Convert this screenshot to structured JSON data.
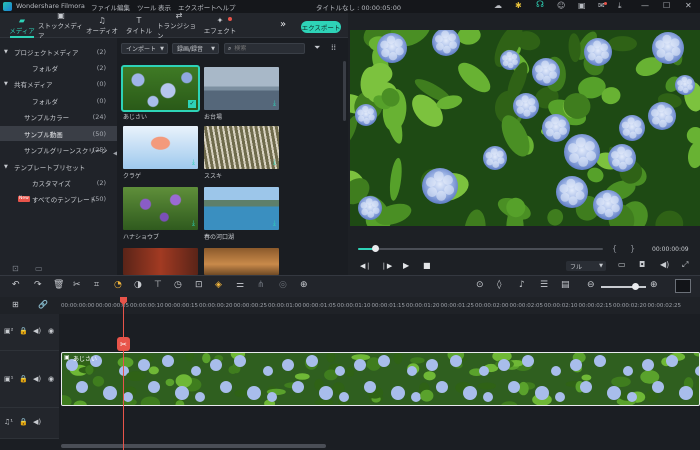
{
  "app": {
    "title": "Wondershare Filmora",
    "menu": [
      "ファイル",
      "編集",
      "ツール",
      "表示",
      "エクスポート",
      "ヘルプ"
    ],
    "project_title": "タイトルなし : 00:00:05:00"
  },
  "tabs": [
    {
      "label": "メディア",
      "icon": "folder-icon"
    },
    {
      "label": "ストックメディア",
      "icon": "image-icon"
    },
    {
      "label": "オーディオ",
      "icon": "music-note-icon"
    },
    {
      "label": "タイトル",
      "icon": "text-icon"
    },
    {
      "label": "トランジション",
      "icon": "transition-icon"
    },
    {
      "label": "エフェクト",
      "icon": "effect-icon"
    }
  ],
  "export_label": "エクスポート",
  "sidebar": [
    {
      "label": "プロジェクトメディア",
      "count": "(2)",
      "indent": 0,
      "arrow": "▼"
    },
    {
      "label": "フォルダ",
      "count": "(2)",
      "indent": 1,
      "arrow": ""
    },
    {
      "label": "共有メディア",
      "count": "(0)",
      "indent": 0,
      "arrow": "▼"
    },
    {
      "label": "フォルダ",
      "count": "(0)",
      "indent": 1,
      "arrow": ""
    },
    {
      "label": "サンプルカラー",
      "count": "(24)",
      "indent": 0,
      "arrow": ""
    },
    {
      "label": "サンプル動画",
      "count": "(50)",
      "indent": 0,
      "arrow": "",
      "selected": true
    },
    {
      "label": "サンプルグリーンスクリーン",
      "count": "(25)",
      "indent": 0,
      "arrow": ""
    },
    {
      "label": "テンプレートプリセット",
      "count": "",
      "indent": 0,
      "arrow": "▼"
    },
    {
      "label": "カスタマイズ",
      "count": "(2)",
      "indent": 1,
      "arrow": ""
    },
    {
      "label": "すべてのテンプレート",
      "count": "(50)",
      "indent": 1,
      "arrow": "",
      "badge": "New"
    }
  ],
  "media_toolbar": {
    "import_label": "インポート",
    "record_label": "録画/録音",
    "search_placeholder": "検索"
  },
  "media_items": [
    {
      "label": "あじさい",
      "scene": "hydrangea",
      "selected": true
    },
    {
      "label": "お台場",
      "scene": "bridge"
    },
    {
      "label": "クラゲ",
      "scene": "jellyfish"
    },
    {
      "label": "ススキ",
      "scene": "grass"
    },
    {
      "label": "ハナショウブ",
      "scene": "iris"
    },
    {
      "label": "春の河口湖",
      "scene": "lake"
    },
    {
      "label": "",
      "scene": "shrine"
    },
    {
      "label": "",
      "scene": "forest"
    }
  ],
  "player": {
    "time": "00:00:00:09",
    "quality": "フル",
    "progress": 0.07
  },
  "ruler_ticks": [
    "00:00:00:00",
    "00:00:00:05",
    "00:00:00:10",
    "00:00:00:15",
    "00:00:00:20",
    "00:00:00:25",
    "00:00:01:00",
    "00:00:01:05",
    "00:00:01:10",
    "00:00:01:15",
    "00:00:01:20",
    "00:00:01:25",
    "00:00:02:00",
    "00:00:02:05",
    "00:00:02:10",
    "00:00:02:15",
    "00:00:02:20",
    "00:00:02:25"
  ],
  "clip": {
    "label": "あじさい"
  },
  "colors": {
    "accent": "#2ed3b7",
    "playhead": "#e8544a",
    "selected": "#3a3e46"
  }
}
